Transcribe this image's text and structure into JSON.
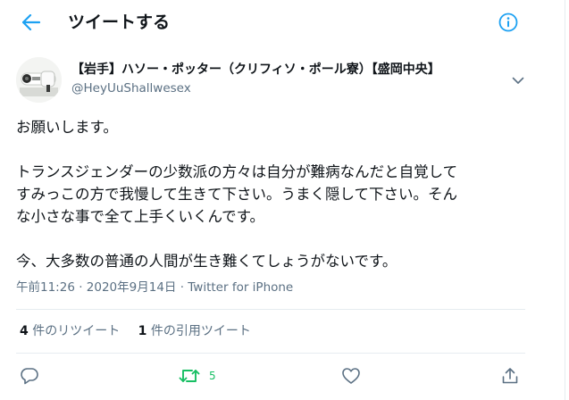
{
  "header": {
    "title": "ツイートする",
    "back_icon": "arrow-left-icon",
    "info_icon": "info-icon"
  },
  "author": {
    "display_name": "【岩手】ハソー・ポッター（クリフィソ・ポール寮）【盛岡中央】",
    "handle": "@HeyUuShallwesex",
    "more_icon": "chevron-down-icon"
  },
  "tweet": {
    "paragraph1": "お願いします。",
    "paragraph2_lines": [
      "トランスジェンダーの少数派の方々は自分が難病なんだと自覚して",
      "すみっこの方で我慢して生きて下さい。うまく隠して下さい。そん",
      "な小さな事で全て上手くいくんです。"
    ],
    "paragraph3": "今、大多数の普通の人間が生き難くてしょうがないです。"
  },
  "meta": {
    "timestamp": "午前11:26 · 2020年9月14日",
    "separator": " · ",
    "source": "Twitter for iPhone"
  },
  "stats": {
    "retweets_count": "4",
    "retweets_label": "件のリツイート",
    "quotes_count": "1",
    "quotes_label": "件の引用ツイート"
  },
  "actions": {
    "reply_icon": "reply-icon",
    "retweet_icon": "retweet-icon",
    "retweet_count": "5",
    "like_icon": "heart-icon",
    "share_icon": "share-icon"
  },
  "colors": {
    "accent": "#1da1f2",
    "secondary_text": "#5b7083",
    "retweet_green": "#17bf63",
    "divider": "#e6ecf0"
  }
}
